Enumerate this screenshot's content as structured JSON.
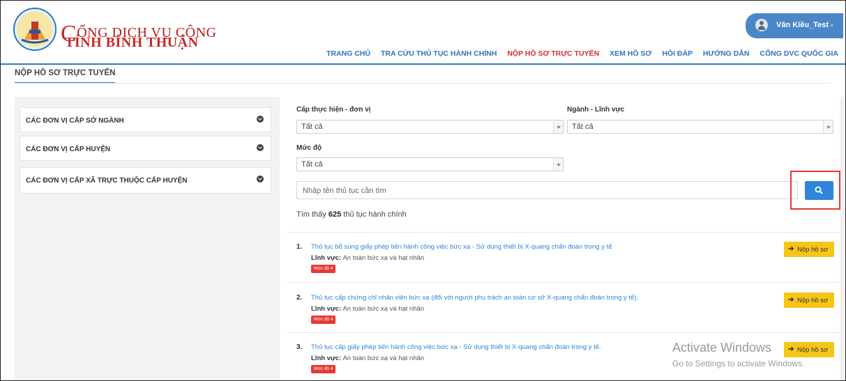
{
  "header": {
    "brand_line1_cap": "C",
    "brand_line1_rest": "ỔNG DỊCH VỤ CÔNG",
    "brand_line2": "TỈNH BÌNH THUẬN",
    "user_name": "Văn Kiều_Test -"
  },
  "nav": [
    {
      "label": "TRANG CHỦ",
      "active": false
    },
    {
      "label": "TRA CỨU THỦ TỤC HÀNH CHÍNH",
      "active": false
    },
    {
      "label": "NỘP HỒ SƠ TRỰC TUYẾN",
      "active": true
    },
    {
      "label": "XEM HỒ SƠ",
      "active": false
    },
    {
      "label": "HỎI ĐÁP",
      "active": false
    },
    {
      "label": "HƯỚNG DẪN",
      "active": false
    },
    {
      "label": "CỔNG DVC QUỐC GIA",
      "active": false
    }
  ],
  "page": {
    "title": "NỘP HỒ SƠ TRỰC TUYẾN"
  },
  "sidebar": {
    "items": [
      {
        "label": "CÁC ĐƠN VỊ CẤP SỞ NGÀNH"
      },
      {
        "label": "CÁC ĐƠN VỊ CẤP HUYỆN"
      },
      {
        "label": "CÁC ĐƠN VỊ CẤP XÃ TRỰC THUỘC CẤP HUYỆN"
      }
    ]
  },
  "filters": {
    "level_unit_label": "Cấp thực hiện - đơn vị",
    "level_unit_value": "Tất cả",
    "field_label": "Ngành - Lĩnh vực",
    "field_value": "Tất cả",
    "degree_label": "Mức độ",
    "degree_value": "Tất cả"
  },
  "search": {
    "placeholder": "Nhập tên thủ tục cần tìm",
    "icon": "search-icon"
  },
  "results": {
    "prefix": "Tìm thấy",
    "count": "625",
    "suffix": "thủ tục hành chính",
    "field_label": "Lĩnh vực:",
    "submit_label": "Nộp hồ sơ",
    "items": [
      {
        "num": "1.",
        "title": "Thủ tục bổ sung giấy phép tiến hành công việc bức xạ - Sử dụng thiết bị X-quang chẩn đoán trong y tế",
        "field": "An toàn bức xạ và hạt nhân",
        "badge": "Mức độ 4"
      },
      {
        "num": "2.",
        "title": "Thủ tục cấp chứng chỉ nhân viên bức xạ (đối với người phụ trách an toàn cơ sở X-quang chẩn đoán trong y tế).",
        "field": "An toàn bức xạ và hạt nhân",
        "badge": "Mức độ 4"
      },
      {
        "num": "3.",
        "title": "Thủ tục cấp giấy phép tiến hành công việc bức xạ - Sử dụng thiết bị X-quang chẩn đoán trong y tế.",
        "field": "An toàn bức xạ và hạt nhân",
        "badge": "Mức độ 4"
      }
    ]
  },
  "watermark": {
    "line1": "Activate Windows",
    "line2": "Go to Settings to activate Windows."
  },
  "colors": {
    "primary": "#2f86d9",
    "active_nav": "#d32f2f",
    "brand_red": "#c62828",
    "submit_bg": "#f5c518",
    "badge_bg": "#e53935"
  }
}
